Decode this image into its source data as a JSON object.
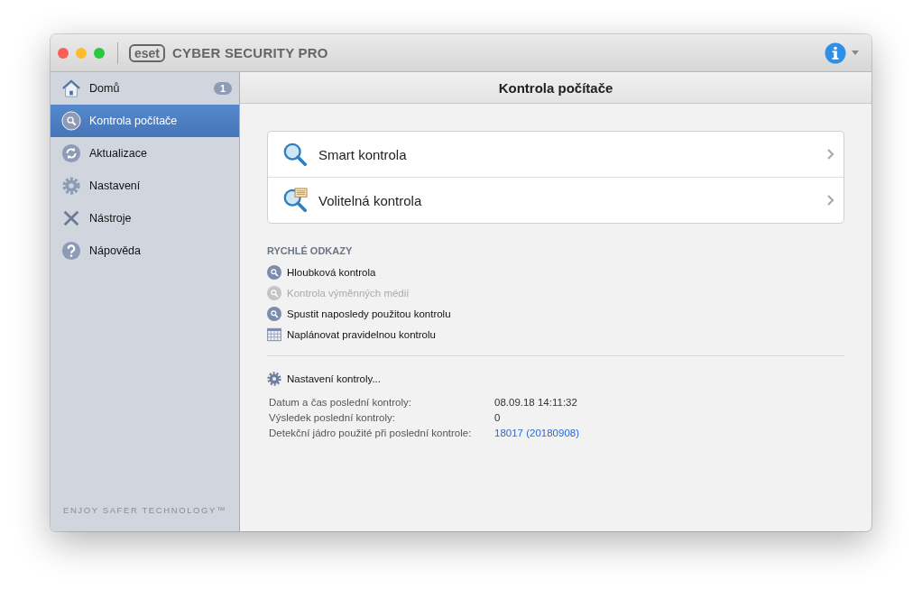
{
  "window": {
    "logo": "eset",
    "title": "CYBER SECURITY PRO"
  },
  "sidebar": {
    "items": [
      {
        "kind": "home",
        "label": "Domů",
        "selected": false,
        "badge": "1"
      },
      {
        "kind": "scan",
        "label": "Kontrola počítače",
        "selected": true
      },
      {
        "kind": "update",
        "label": "Aktualizace",
        "selected": false
      },
      {
        "kind": "setup",
        "label": "Nastavení",
        "selected": false
      },
      {
        "kind": "tools",
        "label": "Nástroje",
        "selected": false
      },
      {
        "kind": "help",
        "label": "Nápověda",
        "selected": false
      }
    ],
    "footer": "ENJOY SAFER TECHNOLOGY™"
  },
  "header": {
    "title": "Kontrola počítače"
  },
  "scan_options": [
    {
      "kind": "smart",
      "label": "Smart kontrola"
    },
    {
      "kind": "custom",
      "label": "Volitelná kontrola"
    }
  ],
  "quick_links": {
    "title": "RYCHLÉ ODKAZY",
    "items": [
      {
        "kind": "scan",
        "label": "Hloubková kontrola",
        "disabled": false
      },
      {
        "kind": "scan",
        "label": "Kontrola výměnných médií",
        "disabled": true
      },
      {
        "kind": "scan",
        "label": "Spustit naposledy použitou kontrolu",
        "disabled": false
      },
      {
        "kind": "calendar",
        "label": "Naplánovat pravidelnou kontrolu",
        "disabled": false
      }
    ]
  },
  "scan_settings": {
    "label": "Nastavení kontroly..."
  },
  "last_scan": [
    {
      "label": "Datum a čas poslední kontroly:",
      "value": "08.09.18 14:11:32",
      "kind": "text"
    },
    {
      "label": "Výsledek poslední kontroly:",
      "value": "0",
      "kind": "text"
    },
    {
      "label": "Detekční jádro použité při poslední kontrole:",
      "value": "18017 (20180908)",
      "kind": "link"
    }
  ]
}
